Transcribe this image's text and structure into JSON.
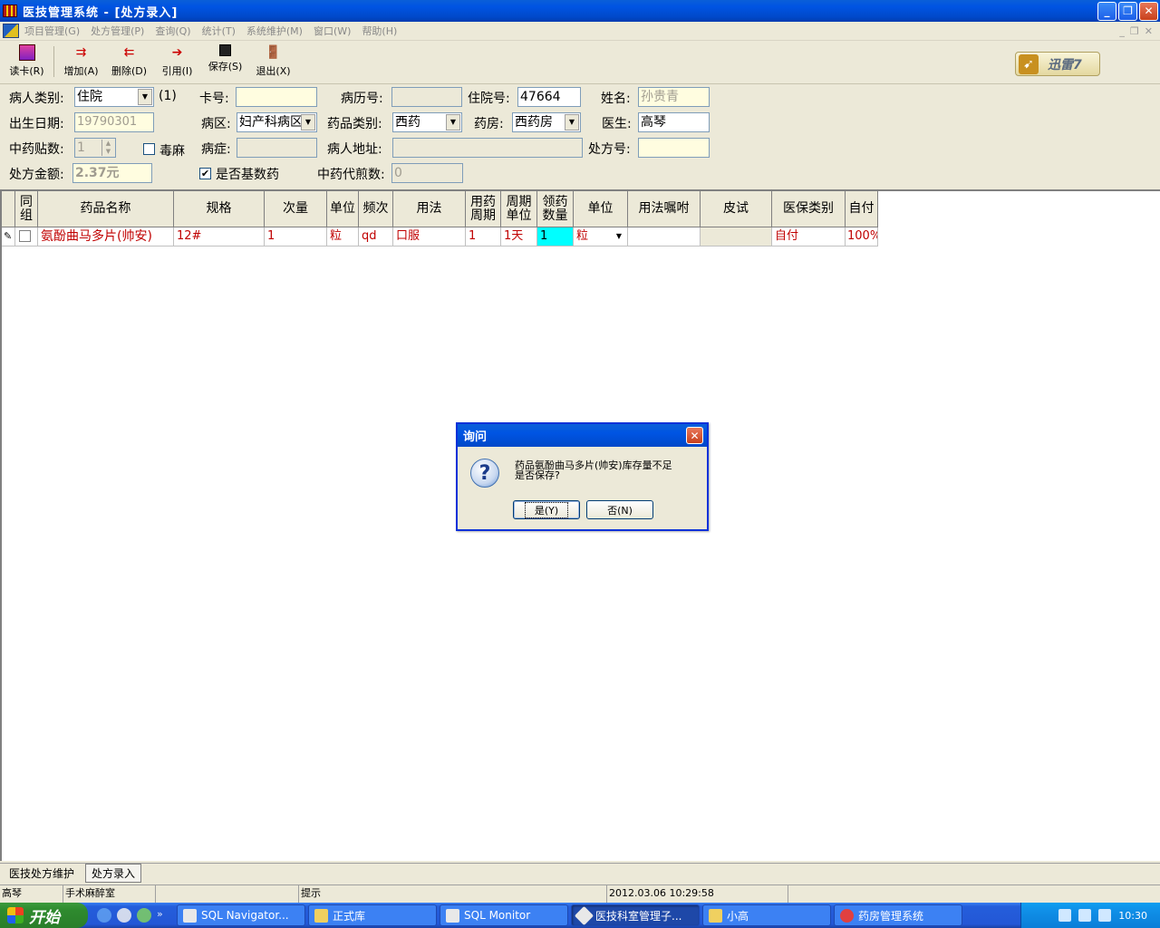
{
  "window": {
    "title": "医技管理系统 - [处方录入]",
    "controls": {
      "minimize": "_",
      "restore": "❐",
      "close": "✕"
    }
  },
  "menu": {
    "items": [
      "项目管理(G)",
      "处方管理(P)",
      "查询(Q)",
      "统计(T)",
      "系统维护(M)",
      "窗口(W)",
      "帮助(H)"
    ],
    "mdi_controls": [
      "_",
      "❐",
      "✕"
    ]
  },
  "toolbar": {
    "read_card": "读卡(R)",
    "add": "增加(A)",
    "delete": "删除(D)",
    "quote": "引用(I)",
    "save": "保存(S)",
    "exit": "退出(X)",
    "xunlei": "迅雷7"
  },
  "form": {
    "patient_type_label": "病人类别:",
    "patient_type_value": "住院",
    "patient_type_count": "(1)",
    "card_no_label": "卡号:",
    "card_no_value": "",
    "record_no_label": "病历号:",
    "record_no_value": "",
    "inpatient_no_label": "住院号:",
    "inpatient_no_value": "47664",
    "name_label": "姓名:",
    "name_value": "孙贵青",
    "birth_label": "出生日期:",
    "birth_value": "19790301",
    "ward_label": "病区:",
    "ward_value": "妇产科病区",
    "drug_type_label": "药品类别:",
    "drug_type_value": "西药",
    "pharmacy_label": "药房:",
    "pharmacy_value": "西药房",
    "doctor_label": "医生:",
    "doctor_value": "高琴",
    "tcm_count_label": "中药贴数:",
    "tcm_count_value": "1",
    "poison_label": "毒麻",
    "disease_label": "病症:",
    "disease_value": "",
    "address_label": "病人地址:",
    "address_value": "",
    "rx_no_label": "处方号:",
    "rx_no_value": "",
    "amount_label": "处方金额:",
    "amount_value": "2.37元",
    "basic_drug_label": "是否基数药",
    "basic_drug_checked": "✔",
    "tcm_decoct_label": "中药代煎数:",
    "tcm_decoct_value": "0"
  },
  "grid": {
    "headers": [
      "同\n组",
      "药品名称",
      "规格",
      "次量",
      "单位",
      "频次",
      "用法",
      "用药\n周期",
      "周期\n单位",
      "领药\n数量",
      "单位",
      "用法嘱咐",
      "皮试",
      "医保类别",
      "自付"
    ],
    "rows": [
      {
        "indicator": "✎",
        "drug_name": "氨酚曲马多片(帅安)",
        "spec": "12#",
        "dose": "1",
        "unit": "粒",
        "frequency": "qd",
        "usage": "口服",
        "period": "1",
        "period_unit": "1天",
        "quantity": "1",
        "qty_unit": "粒",
        "instruction": "",
        "skin_test": "",
        "insurance_type": "自付",
        "self_pay": "100%"
      }
    ]
  },
  "dialog": {
    "title": "询问",
    "icon": "?",
    "message_line1": "药品氨酚曲马多片(帅安)库存量不足",
    "message_line2": "是否保存?",
    "yes_label": "是(Y)",
    "no_label": "否(N)",
    "close": "✕"
  },
  "doc_tabs": [
    "医技处方维护",
    "处方录入"
  ],
  "status": {
    "user": "高琴",
    "department": "手术麻醉室",
    "blank": "",
    "hint": "提示",
    "datetime": "2012.03.06 10:29:58"
  },
  "taskbar": {
    "start": "开始",
    "tasks": [
      "SQL Navigator...",
      "正式库",
      "SQL Monitor",
      "医技科室管理子...",
      "小高",
      "药房管理系统"
    ],
    "clock": "10:30",
    "quicklaunch_more": "»"
  }
}
